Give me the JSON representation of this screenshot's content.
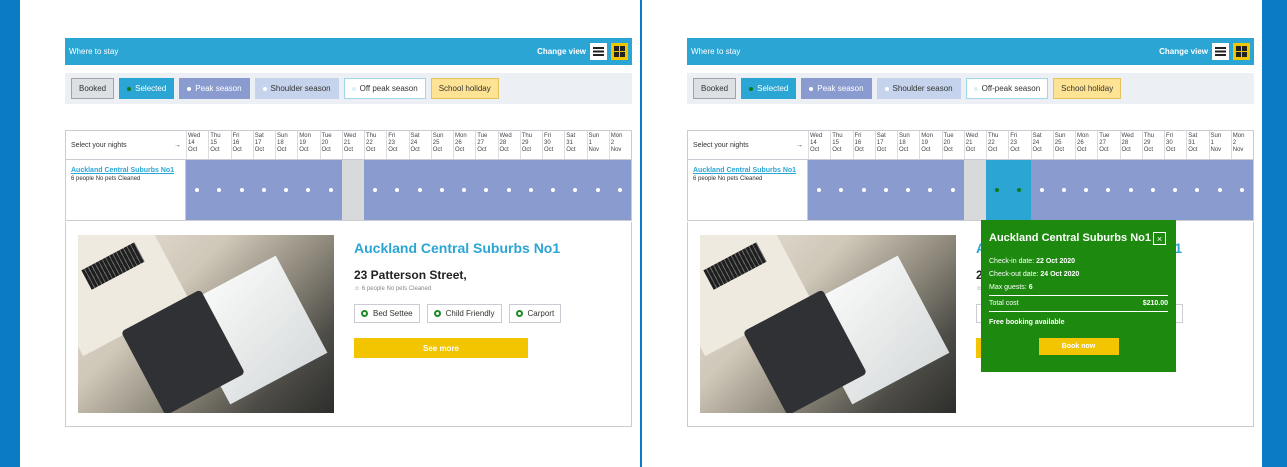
{
  "header": {
    "title": "Where to stay",
    "change_view_label": "Change view",
    "icons": [
      "list-icon",
      "grid-icon"
    ]
  },
  "legend": {
    "booked": "Booked",
    "selected": "Selected",
    "peak": "Peak season",
    "shoulder": "Shoulder season",
    "offpeak_a": "Off peak season",
    "offpeak_b": "Off-peak season",
    "school": "School holiday"
  },
  "calendar": {
    "select_nights_label": "Select your nights",
    "days": [
      {
        "dow": "Wed",
        "day": "14",
        "mon": "Oct"
      },
      {
        "dow": "Thu",
        "day": "15",
        "mon": "Oct"
      },
      {
        "dow": "Fri",
        "day": "16",
        "mon": "Oct"
      },
      {
        "dow": "Sat",
        "day": "17",
        "mon": "Oct"
      },
      {
        "dow": "Sun",
        "day": "18",
        "mon": "Oct"
      },
      {
        "dow": "Mon",
        "day": "19",
        "mon": "Oct"
      },
      {
        "dow": "Tue",
        "day": "20",
        "mon": "Oct"
      },
      {
        "dow": "Wed",
        "day": "21",
        "mon": "Oct"
      },
      {
        "dow": "Thu",
        "day": "22",
        "mon": "Oct"
      },
      {
        "dow": "Fri",
        "day": "23",
        "mon": "Oct"
      },
      {
        "dow": "Sat",
        "day": "24",
        "mon": "Oct"
      },
      {
        "dow": "Sun",
        "day": "25",
        "mon": "Oct"
      },
      {
        "dow": "Mon",
        "day": "26",
        "mon": "Oct"
      },
      {
        "dow": "Tue",
        "day": "27",
        "mon": "Oct"
      },
      {
        "dow": "Wed",
        "day": "28",
        "mon": "Oct"
      },
      {
        "dow": "Thu",
        "day": "29",
        "mon": "Oct"
      },
      {
        "dow": "Fri",
        "day": "30",
        "mon": "Oct"
      },
      {
        "dow": "Sat",
        "day": "31",
        "mon": "Oct"
      },
      {
        "dow": "Sun",
        "day": "1",
        "mon": "Nov"
      },
      {
        "dow": "Mon",
        "day": "2",
        "mon": "Nov"
      }
    ],
    "property_name": "Auckland Central Suburbs No1",
    "property_meta": "6 people No pets Cleaned",
    "booked_index": 7,
    "selected_indices_panel_b": [
      8,
      9
    ]
  },
  "card": {
    "title": "Auckland Central Suburbs No1",
    "street": "23 Patterson Street,",
    "meta": "6 people  No pets  Cleaned",
    "features": [
      "Bed Settee",
      "Child Friendly",
      "Carport"
    ],
    "see_more": "See more"
  },
  "popup": {
    "title": "Auckland Central Suburbs No1",
    "close": "×",
    "checkin_label": "Check-in date:",
    "checkin_value": "22 Oct 2020",
    "checkout_label": "Check-out date:",
    "checkout_value": "24 Oct 2020",
    "guests_label": "Max guests:",
    "guests_value": "6",
    "total_label": "Total cost",
    "total_value": "$210.00",
    "free_booking": "Free booking available",
    "book_now": "Book now"
  },
  "colors": {
    "background": "#0a7bc4",
    "header": "#2aa5d4",
    "peak": "#8a9bd0",
    "popup": "#1d8a0f",
    "accent": "#f2c500"
  }
}
